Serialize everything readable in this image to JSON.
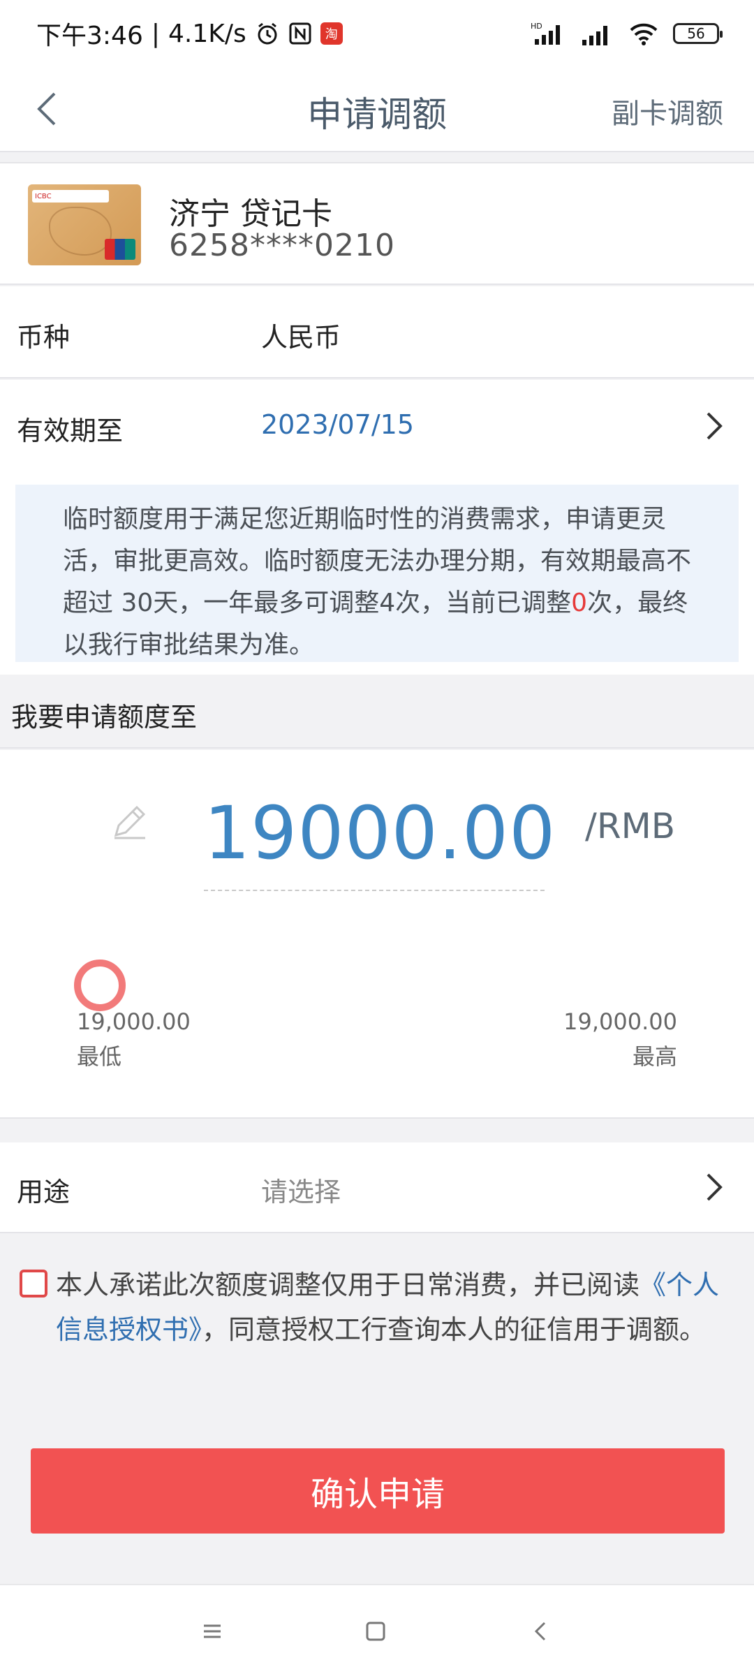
{
  "status_bar": {
    "time": "下午3:46",
    "speed": "4.1K/s",
    "battery": "56",
    "network_label": "HD"
  },
  "nav": {
    "title": "申请调额",
    "right_action": "副卡调额"
  },
  "card": {
    "name": "济宁 贷记卡",
    "number": "6258****0210"
  },
  "currency": {
    "label": "币种",
    "value": "人民币"
  },
  "validity": {
    "label": "有效期至",
    "value": "2023/07/15"
  },
  "notice": {
    "text_a": "临时额度用于满足您近期临时性的消费需求，申请更灵活，审批更高效。临时额度无法办理分期，有效期最高不超过 30天，一年最多可调整4次，当前已调整",
    "count": "0",
    "text_b": "次，最终以我行审批结果为准。"
  },
  "amount_section": {
    "header": "我要申请额度至",
    "amount": "19000.00",
    "unit": "/RMB",
    "slider_level": 0,
    "min_value": "19,000.00",
    "min_label": "最低",
    "max_value": "19,000.00",
    "max_label": "最高"
  },
  "purpose": {
    "label": "用途",
    "placeholder": "请选择"
  },
  "agreement": {
    "text_a": "本人承诺此次额度调整仅用于日常消费，并已阅读",
    "link": "《个人信息授权书》",
    "text_b": "，同意授权工行查询本人的征信用于调额。",
    "checked": false
  },
  "confirm_button": "确认申请",
  "colors": {
    "accent_blue": "#3e86c2",
    "link_blue": "#2f6eb0",
    "primary_red": "#f25252",
    "notice_bg": "#edf3fb"
  }
}
